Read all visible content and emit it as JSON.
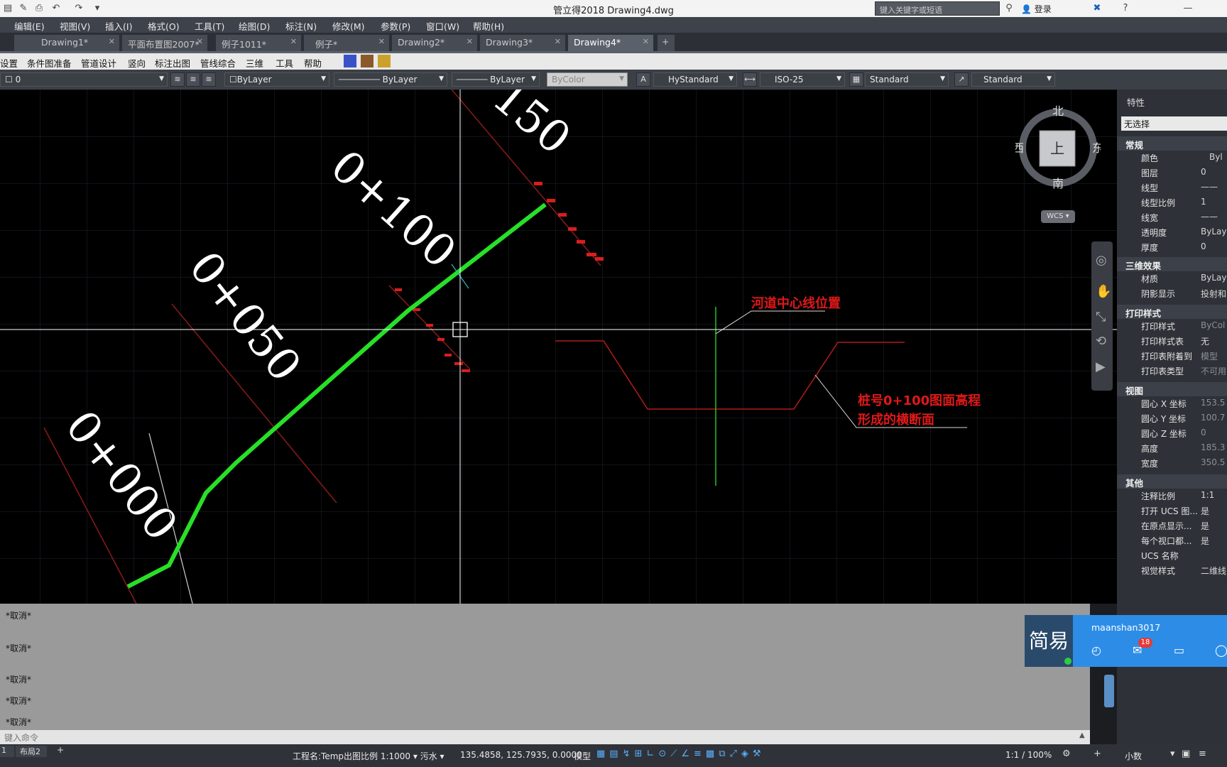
{
  "titlebar": {
    "title": "管立得2018    Drawing4.dwg",
    "search_placeholder": "键入关键字或短语",
    "login": "登录"
  },
  "menu": [
    "编辑(E)",
    "视图(V)",
    "插入(I)",
    "格式(O)",
    "工具(T)",
    "绘图(D)",
    "标注(N)",
    "修改(M)",
    "参数(P)",
    "窗口(W)",
    "帮助(H)"
  ],
  "tabs": [
    {
      "label": "Drawing1*",
      "active": false
    },
    {
      "label": "平面布置图2007*",
      "active": false
    },
    {
      "label": "例子1011*",
      "active": false
    },
    {
      "label": "例子*",
      "active": false
    },
    {
      "label": "Drawing2*",
      "active": false
    },
    {
      "label": "Drawing3*",
      "active": false
    },
    {
      "label": "Drawing4*",
      "active": true
    }
  ],
  "ribbon": [
    "设置",
    "条件图准备",
    "管道设计",
    "竖向",
    "标注出图",
    "管线综合",
    "三维",
    "工具",
    "帮助"
  ],
  "props": {
    "layer": "0",
    "color": "ByLayer",
    "linetype": "ByLayer",
    "lineweight": "ByLayer",
    "plotstyle": "ByColor",
    "textstyle": "HyStandard",
    "dimstyle": "ISO-25",
    "tablestyle": "Standard",
    "mleaderstyle": "Standard"
  },
  "drawing": {
    "labels": [
      "0+000",
      "0+050",
      "0+100",
      "150"
    ],
    "note1": "河道中心线位置",
    "note2_line1": "桩号0+100图面高程",
    "note2_line2": "形成的横断面"
  },
  "viewcube": {
    "north": "北",
    "south": "南",
    "east": "东",
    "west": "西",
    "top": "上",
    "wcs": "WCS"
  },
  "palette": {
    "title": "特性",
    "selection": "无选择",
    "sections": {
      "general": "常规",
      "threed": "三维效果",
      "plot": "打印样式",
      "view": "视图",
      "misc": "其他"
    },
    "general_rows": [
      {
        "k": "颜色",
        "v": "Byl"
      },
      {
        "k": "图层",
        "v": "0"
      },
      {
        "k": "线型",
        "v": "——"
      },
      {
        "k": "线型比例",
        "v": "1"
      },
      {
        "k": "线宽",
        "v": "——"
      },
      {
        "k": "透明度",
        "v": "ByLay"
      },
      {
        "k": "厚度",
        "v": "0"
      }
    ],
    "threed_rows": [
      {
        "k": "材质",
        "v": "ByLay"
      },
      {
        "k": "阴影显示",
        "v": "投射和"
      }
    ],
    "plot_rows": [
      {
        "k": "打印样式",
        "v": "ByCol"
      },
      {
        "k": "打印样式表",
        "v": "无"
      },
      {
        "k": "打印表附着到",
        "v": "模型"
      },
      {
        "k": "打印表类型",
        "v": "不可用"
      }
    ],
    "view_rows": [
      {
        "k": "圆心 X 坐标",
        "v": "153.5"
      },
      {
        "k": "圆心 Y 坐标",
        "v": "100.7"
      },
      {
        "k": "圆心 Z 坐标",
        "v": "0"
      },
      {
        "k": "高度",
        "v": "185.3"
      },
      {
        "k": "宽度",
        "v": "350.5"
      }
    ],
    "misc_rows": [
      {
        "k": "注释比例",
        "v": "1:1"
      },
      {
        "k": "打开 UCS 图...",
        "v": "是"
      },
      {
        "k": "在原点显示...",
        "v": "是"
      },
      {
        "k": "每个视口都...",
        "v": "是"
      },
      {
        "k": "UCS 名称",
        "v": ""
      },
      {
        "k": "视觉样式",
        "v": "二维线"
      }
    ]
  },
  "command": {
    "lines": [
      "*取消*",
      "*取消*",
      "*取消*",
      "*取消*",
      "*取消*"
    ],
    "placeholder": "键入命令"
  },
  "status": {
    "layout_tab1": "1",
    "layout_tab2": "布局2",
    "project": "工程名:Temp出图比例 1:1000",
    "pipe": "污水",
    "coords": "135.4858, 125.7935, 0.0000",
    "space": "模型",
    "scale": "1:1 / 100%",
    "units": "小数"
  },
  "notification": {
    "logo": "简易",
    "user": "maanshan3017",
    "badge": "18"
  }
}
